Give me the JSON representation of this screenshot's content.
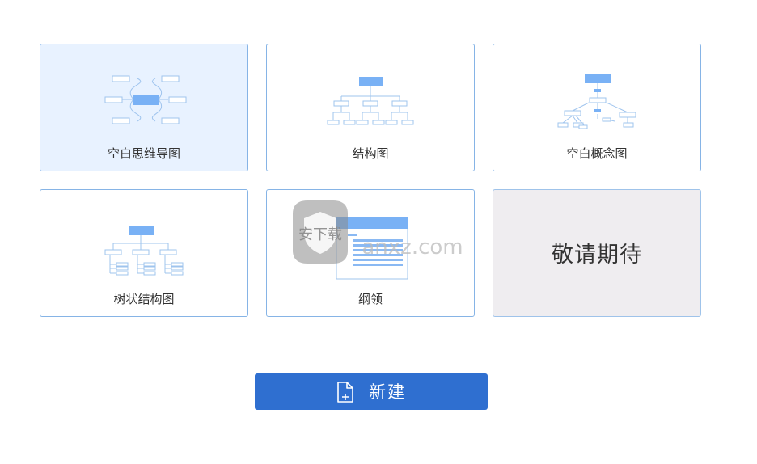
{
  "templates": [
    {
      "id": "blank-mindmap",
      "label": "空白思维导图"
    },
    {
      "id": "structure",
      "label": "结构图"
    },
    {
      "id": "blank-concept",
      "label": "空白概念图"
    },
    {
      "id": "tree-structure",
      "label": "树状结构图"
    },
    {
      "id": "outline",
      "label": "纲领"
    }
  ],
  "coming_soon": "敬请期待",
  "new_button": {
    "label": "新建"
  },
  "watermark": {
    "text": "安下载",
    "domain": "anxz.com"
  },
  "colors": {
    "accent": "#2f6fd0",
    "card_border": "#86b4e6",
    "selected_bg": "#e8f2ff",
    "disabled_bg": "#efedf0",
    "diagram_fill": "#79b1f5",
    "diagram_line": "#9fc4ee"
  }
}
